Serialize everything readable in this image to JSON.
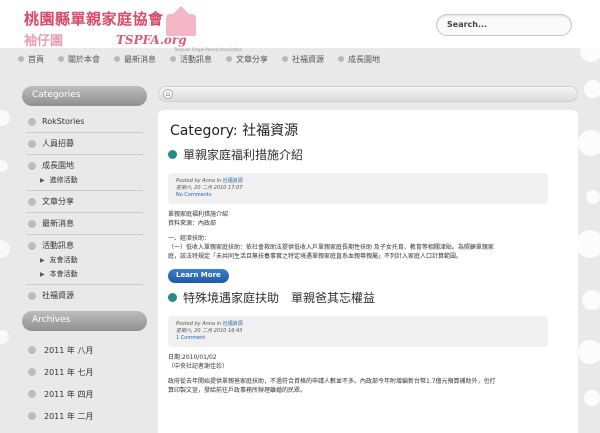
{
  "header": {
    "logo_line1": "桃園縣單親家庭協會",
    "logo_line2": "袖仔園",
    "logo_tspfa": "TSPFA.org",
    "logo_sub": "Taoyuan Single Parent Association",
    "search_placeholder": "Search..."
  },
  "nav": {
    "items": [
      {
        "label": "首頁"
      },
      {
        "label": "關於本會"
      },
      {
        "label": "最新消息"
      },
      {
        "label": "活動訊息"
      },
      {
        "label": "文章分享"
      },
      {
        "label": "社福資源"
      },
      {
        "label": "成長園地"
      }
    ]
  },
  "sidebar": {
    "categories_title": "Categories",
    "items": [
      {
        "label": "RokStories"
      },
      {
        "label": "人員招募"
      },
      {
        "label": "成長園地"
      },
      {
        "label": "進修活動",
        "sub": true
      },
      {
        "label": "文章分享"
      },
      {
        "label": "最新消息"
      },
      {
        "label": "活動訊息"
      },
      {
        "label": "友會活動",
        "sub": true
      },
      {
        "label": "本會活動",
        "sub": true
      },
      {
        "label": "社福資源"
      }
    ],
    "archives_title": "Archives",
    "archives": [
      {
        "label": "2011 年 八月"
      },
      {
        "label": "2011 年 七月"
      },
      {
        "label": "2011 年 四月"
      },
      {
        "label": "2011 年 二月"
      }
    ]
  },
  "main": {
    "home_icon": "home-icon",
    "category_title": "Category: 社福資源",
    "post1": {
      "title": "單親家庭福利措施介紹",
      "meta_line1_prefix": "Posted by Anna in",
      "meta_line1_link": "社福資源",
      "meta_line2": "星期六, 20 二月 2010 17:07",
      "comments": "No Comments",
      "body_lines": [
        "單親家庭福利措施介紹",
        "資料來源：內政部",
        "",
        "一、經濟扶助：",
        "（一）低收入單親家庭扶助：依社會救助法提供低收入戶單親家庭長期性扶助 及子女托育、教育等相關津貼。為照顧單親家",
        "庭，該法特規定「未共同生活且無扶養事實之特定境遇單親家庭直系血親尊親屬」不列計入家庭人口計算範圍。"
      ],
      "learn_more": "Learn More"
    },
    "post2": {
      "title": "特殊境遇家庭扶助　單親爸其忘權益",
      "meta_line1_prefix": "Posted by Anna in",
      "meta_line1_link": "社福資源",
      "meta_line2": "星期六, 20 二月 2010 16:43",
      "comments": "1 Comment",
      "body_lines": [
        "日期:2010/01/02",
        "（中央社記者謝佳珍）",
        "",
        "政府從去年開始提供單親爸家庭扶助，不過符合資格的申請人數並不多。內政部今年附增編新台幣1.7億元預算補助外，也打",
        "算印製文宣，發給前往戶政事務所辦理離婚的民眾。"
      ]
    }
  },
  "colors": {
    "accent": "#2a8a8a",
    "link": "#2266aa",
    "button": "#2a6cc0",
    "logo": "#d94a6a"
  }
}
